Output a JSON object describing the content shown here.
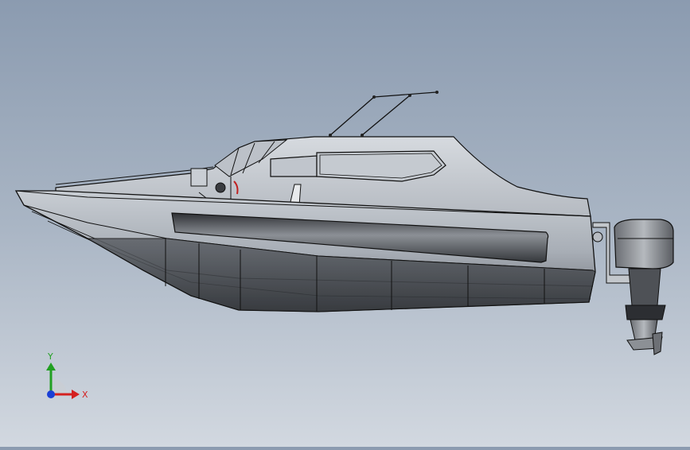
{
  "viewport": {
    "model": "boat-with-outboard-motor"
  },
  "triad": {
    "x_label": "X",
    "y_label": "Y",
    "x_color": "#d42020",
    "y_color": "#22a022",
    "z_color": "#1a3fd6"
  },
  "colors": {
    "background_top": "#8b9bb0",
    "background_bottom": "#d2d8e0",
    "hull_light": "#b9bfc6",
    "hull_dark": "#4a4d52",
    "outline": "#111111"
  }
}
